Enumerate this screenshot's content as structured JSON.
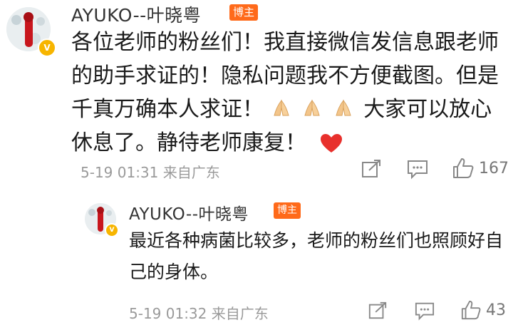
{
  "comment": {
    "username": "AYUKO--叶晓粤",
    "badge": "博主",
    "text_part1": "各位老师的粉丝们！我直接微信发信息跟老师的助手求证的！隐私问题我不方便截图。但是千真万确本人求证！",
    "text_part2": "大家可以放心休息了。静待老师康复！",
    "emojis": [
      "pray-hands",
      "pray-hands",
      "pray-hands"
    ],
    "time": "5-19 01:31",
    "location": "来自广东",
    "like_count": "167"
  },
  "reply": {
    "username": "AYUKO--叶晓粤",
    "badge": "博主",
    "text": "最近各种病菌比较多，老师的粉丝们也照顾好自己的身体。",
    "time": "5-19 01:32",
    "location": "来自广东",
    "like_count": "43"
  },
  "colors": {
    "badge": "#ff6a1a",
    "verified": "#f7b500",
    "heart": "#e8302c",
    "meta": "#9a9a9a"
  }
}
